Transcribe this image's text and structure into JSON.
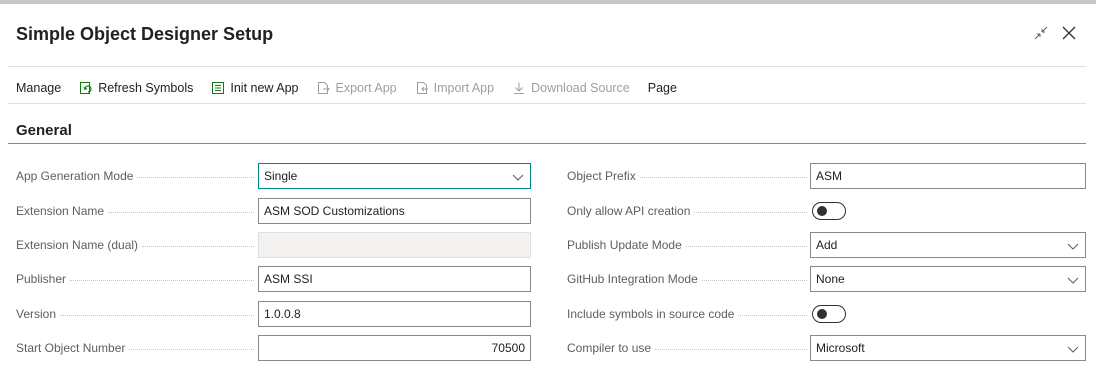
{
  "window": {
    "title": "Simple Object Designer Setup",
    "collapse_icon": "collapse-arrows-icon",
    "close_icon": "close-icon"
  },
  "actions": [
    {
      "label": "Manage",
      "enabled": true,
      "icon": ""
    },
    {
      "label": "Refresh Symbols",
      "enabled": true,
      "icon": "refresh-symbols-icon"
    },
    {
      "label": "Init new App",
      "enabled": true,
      "icon": "init-app-icon"
    },
    {
      "label": "Export App",
      "enabled": false,
      "icon": "export-icon"
    },
    {
      "label": "Import App",
      "enabled": false,
      "icon": "import-icon"
    },
    {
      "label": "Download Source",
      "enabled": false,
      "icon": "download-icon"
    },
    {
      "label": "Page",
      "enabled": true,
      "icon": ""
    }
  ],
  "general": {
    "title": "General",
    "left_fields": [
      {
        "label": "App Generation Mode",
        "value": "Single",
        "type": "select"
      },
      {
        "label": "Extension Name",
        "value": "ASM SOD Customizations",
        "type": "text"
      },
      {
        "label": "Extension Name (dual)",
        "value": "",
        "type": "text-disabled"
      },
      {
        "label": "Publisher",
        "value": "ASM SSI",
        "type": "text"
      },
      {
        "label": "Version",
        "value": "1.0.0.8",
        "type": "text"
      },
      {
        "label": "Start Object Number",
        "value": "70500",
        "type": "number"
      }
    ],
    "right_fields": [
      {
        "label": "Object Prefix",
        "value": "ASM",
        "type": "text"
      },
      {
        "label": "Only allow API creation",
        "value": "Off",
        "type": "toggle"
      },
      {
        "label": "Publish Update Mode",
        "value": "Add",
        "type": "select"
      },
      {
        "label": "GitHub Integration Mode",
        "value": "None",
        "type": "select"
      },
      {
        "label": "Include symbols in source code",
        "value": "Off",
        "type": "toggle"
      },
      {
        "label": "Compiler to use",
        "value": "Microsoft",
        "type": "select"
      }
    ]
  },
  "colors": {
    "accent": "#008489",
    "border": "#8a8886",
    "disabled_text": "#a19f9d",
    "icon_green": "#107c10"
  }
}
